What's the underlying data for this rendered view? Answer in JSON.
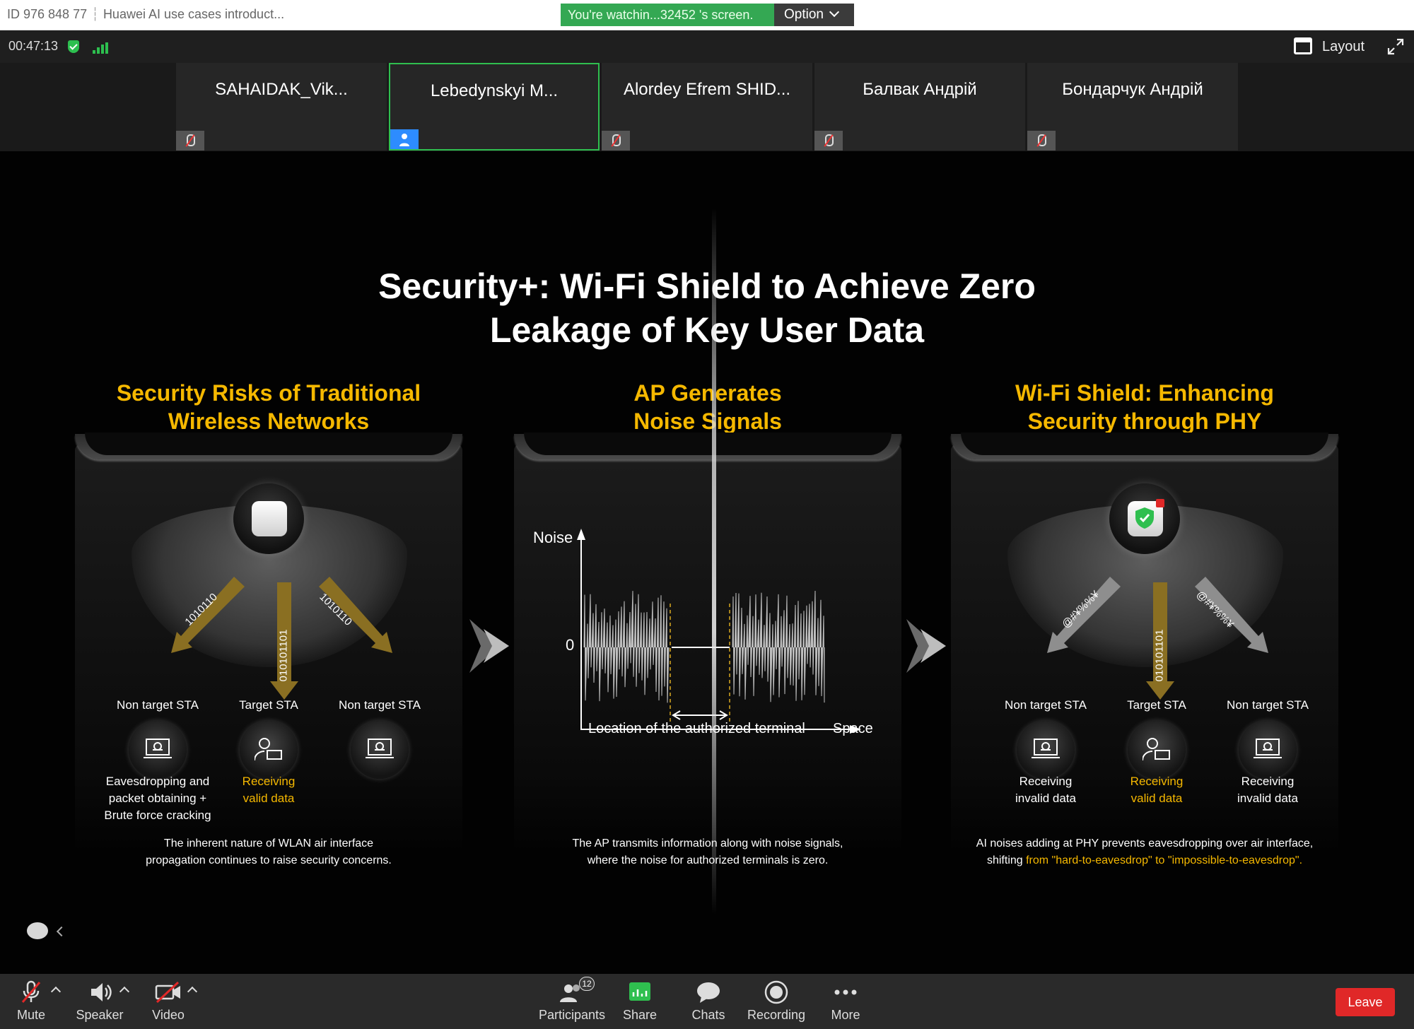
{
  "titlebar": {
    "meeting_id": "ID 976 848 77",
    "meeting_topic": "Huawei AI use cases introduct...",
    "watching_text": "You're watchin...32452 's screen.",
    "option_label": "Option"
  },
  "status": {
    "timer": "00:47:13",
    "layout_label": "Layout"
  },
  "participants": [
    {
      "name": "SAHAIDAK_Vik...",
      "muted": true
    },
    {
      "name": "Lebedynskyi M...",
      "muted": false,
      "active": true
    },
    {
      "name": "Alordey Efrem SHID...",
      "muted": true
    },
    {
      "name": "Балвак Андрій",
      "muted": true
    },
    {
      "name": "Бондарчук Андрій",
      "muted": true
    }
  ],
  "slide": {
    "title_line1": "Security+: Wi-Fi Shield to Achieve Zero",
    "title_line2": "Leakage of Key User Data",
    "panel_left": {
      "title_line1": "Security Risks of Traditional",
      "title_line2": "Wireless Networks",
      "beam_left": "1010110",
      "beam_center": "010101101",
      "beam_right": "1010110",
      "sta_left_label": "Non target STA",
      "sta_center_label": "Target STA",
      "sta_right_label": "Non target STA",
      "sta_left_desc_1": "Eavesdropping and",
      "sta_left_desc_2": "packet obtaining +",
      "sta_left_desc_3": "Brute force cracking",
      "sta_center_desc_1": "Receiving",
      "sta_center_desc_2": "valid data",
      "footer_1": "The inherent nature of WLAN air interface",
      "footer_2": "propagation continues to raise security concerns."
    },
    "panel_middle": {
      "title_line1": "AP Generates",
      "title_line2": "Noise Signals",
      "chart_ylabel": "Noise",
      "chart_zero": "0",
      "chart_xlabel_zone": "Location of the authorized terminal",
      "chart_xlabel": "Space",
      "footer_1": "The AP transmits information along with noise signals,",
      "footer_2": "where the noise for authorized terminals is zero."
    },
    "panel_right": {
      "title_line1": "Wi-Fi Shield: Enhancing",
      "title_line2": "Security through PHY",
      "beam_left": "@#¥%%¥",
      "beam_center": "010101101",
      "beam_right": "@#¥%%¥",
      "sta_left_label": "Non target STA",
      "sta_center_label": "Target STA",
      "sta_right_label": "Non target STA",
      "sta_left_desc_1": "Receiving",
      "sta_left_desc_2": "invalid data",
      "sta_center_desc_1": "Receiving",
      "sta_center_desc_2": "valid data",
      "sta_right_desc_1": "Receiving",
      "sta_right_desc_2": "invalid data",
      "footer_1": "AI noises adding at PHY prevents eavesdropping over air interface,",
      "footer_2_pre": "shifting ",
      "footer_2_gold": "from \"hard-to-eavesdrop\" to \"impossible-to-eavesdrop\"",
      "footer_2_post": "."
    }
  },
  "toolbar": {
    "mute": "Mute",
    "speaker": "Speaker",
    "video": "Video",
    "participants": "Participants",
    "participants_count": "12",
    "share": "Share",
    "chats": "Chats",
    "recording": "Recording",
    "more": "More",
    "leave": "Leave"
  },
  "colors": {
    "accent_gold": "#f5b800",
    "active_green": "#2fbf4f",
    "leave_red": "#e02828"
  }
}
